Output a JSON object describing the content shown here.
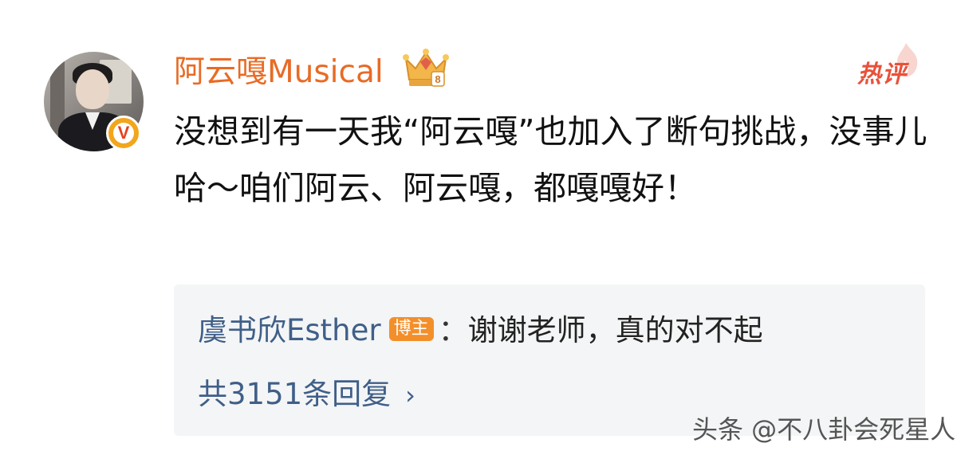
{
  "comment": {
    "username": "阿云嘎Musical",
    "hot_label": "热评",
    "text": "没想到有一天我“阿云嘎”也加入了断句挑战，没事儿哈～咱们阿云、阿云嘎，都嘎嘎好！",
    "verified_badge": "V",
    "crown_level": "8",
    "reply": {
      "user": "虞书欣Esther",
      "role_tag": "博主",
      "separator": "：",
      "text": "谢谢老师，真的对不起",
      "total_label": "共3151条回复",
      "chevron": "›"
    }
  },
  "watermark": "头条 @不八卦会死星人",
  "colors": {
    "username": "#e86b25",
    "reply_link": "#3f5f88",
    "blogger_tag": "#f38f2a",
    "hot_badge": "#e8513a",
    "reply_bg": "#f4f5f6"
  }
}
